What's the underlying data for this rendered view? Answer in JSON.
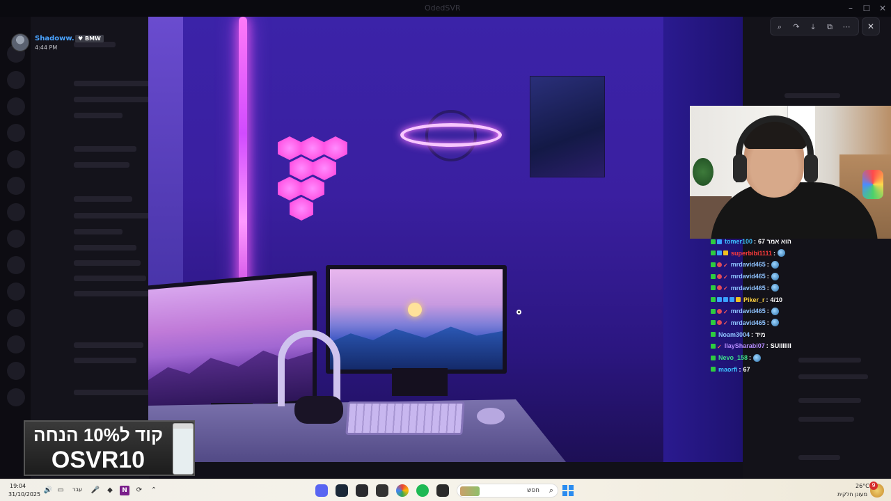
{
  "window": {
    "title": "OdedSVR"
  },
  "viewer": {
    "username": "Shadoww.",
    "user_tag": "BMW",
    "timestamp": "4:44 PM"
  },
  "chat": [
    {
      "name": "tomer100",
      "name_color": "#3ec1ff",
      "message": "הוא אמר 67",
      "badges": [
        "k",
        "b"
      ]
    },
    {
      "name": "superbibi1111",
      "name_color": "#ff3b3b",
      "message": "",
      "emote": true,
      "badges": [
        "k",
        "b",
        "s"
      ]
    },
    {
      "name": "mrdavid465",
      "name_color": "#8fc3ff",
      "message": "",
      "emote": true,
      "badges": [
        "k",
        "h",
        "c"
      ]
    },
    {
      "name": "mrdavid465",
      "name_color": "#8fc3ff",
      "message": "",
      "emote": true,
      "badges": [
        "k",
        "h",
        "c"
      ]
    },
    {
      "name": "mrdavid465",
      "name_color": "#8fc3ff",
      "message": "",
      "emote": true,
      "badges": [
        "k",
        "h",
        "c"
      ]
    },
    {
      "name": "Piker_r",
      "name_color": "#ffd23f",
      "message": "4/10",
      "badges": [
        "k",
        "b",
        "b",
        "b",
        "s"
      ]
    },
    {
      "name": "mrdavid465",
      "name_color": "#8fc3ff",
      "message": "",
      "emote": true,
      "badges": [
        "k",
        "h",
        "c"
      ]
    },
    {
      "name": "mrdavid465",
      "name_color": "#8fc3ff",
      "message": "",
      "emote": true,
      "badges": [
        "k",
        "h",
        "c"
      ]
    },
    {
      "name": "Noam3004",
      "name_color": "#8fc3ff",
      "message": "מיד",
      "badges": [
        "k"
      ]
    },
    {
      "name": "IlaySharabi07",
      "name_color": "#b68cff",
      "message": "SUIIIIIII",
      "badges": [
        "k",
        "c"
      ]
    },
    {
      "name": "Nevo_158",
      "name_color": "#3ee08a",
      "message": "",
      "emote": true,
      "badges": [
        "k"
      ]
    },
    {
      "name": "maorfi",
      "name_color": "#3ec1ff",
      "message": "67",
      "badges": [
        "k"
      ]
    }
  ],
  "promo": {
    "line1": "קוד ל10% הנחה",
    "line2": "OSVR10"
  },
  "taskbar": {
    "time": "19:04",
    "date": "31/10/2025",
    "language": "עבר",
    "search_label": "חפש",
    "weather_temp": "26°C",
    "weather_desc": "מעונן חלקית",
    "notification_count": "9"
  },
  "colors": {
    "accent": "#4aa3ff",
    "stream_purple": "#3b23a8",
    "taskbar_bg": "#f1efe8"
  }
}
